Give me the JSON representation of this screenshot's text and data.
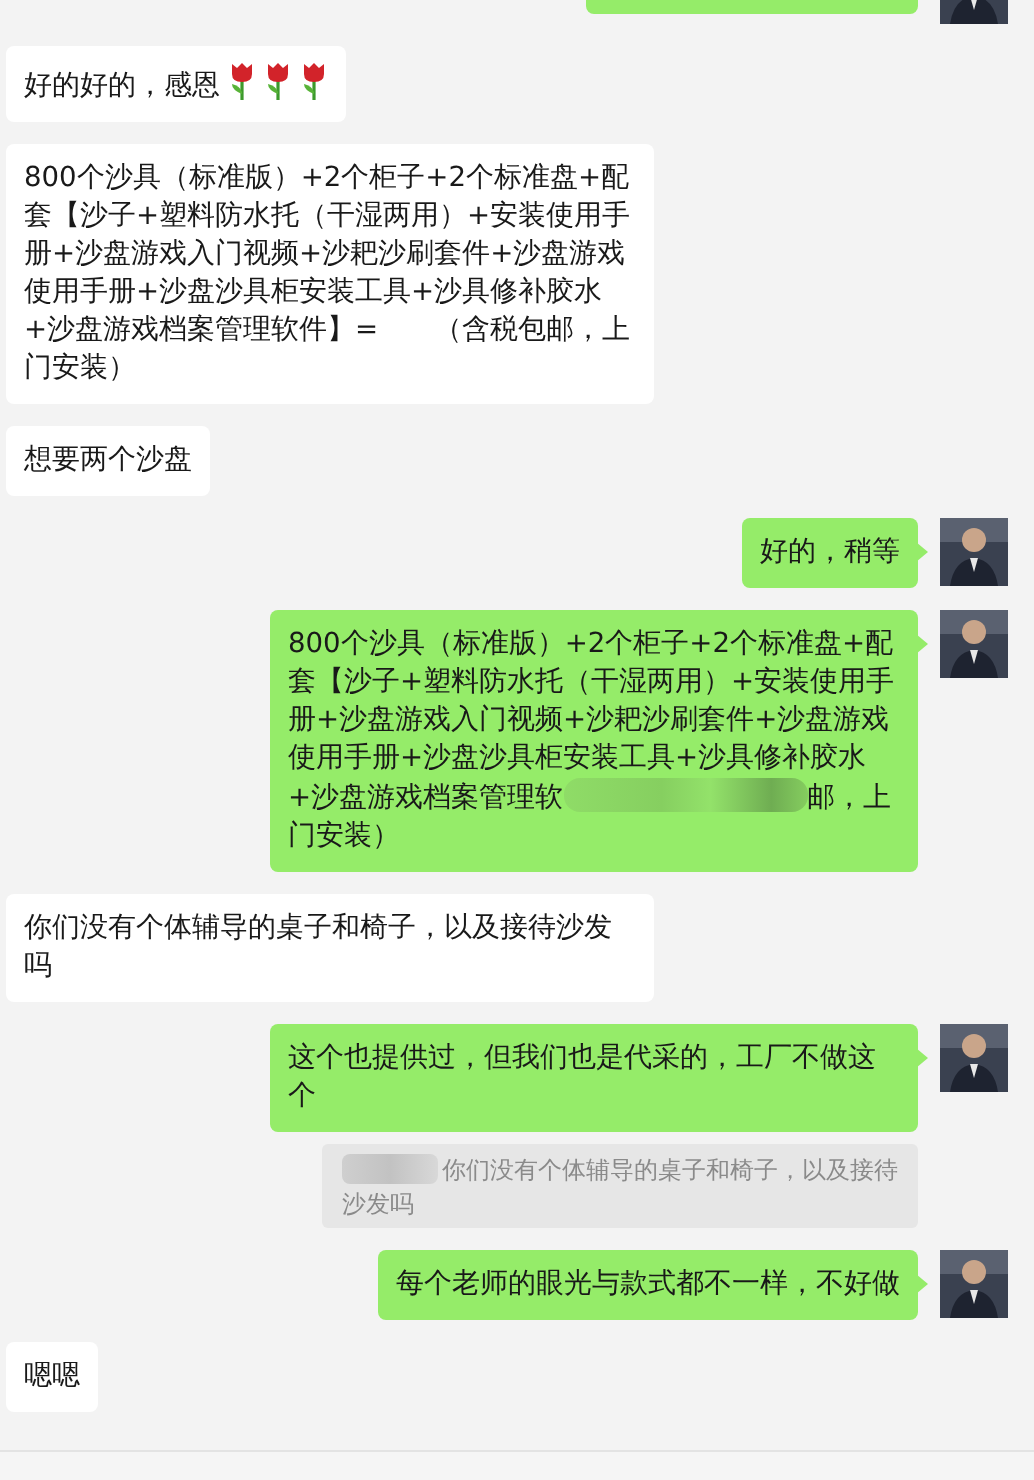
{
  "messages": [
    {
      "kind": "cut",
      "outgoing": true
    },
    {
      "kind": "text",
      "outgoing": false,
      "text": "好的好的，感恩",
      "emojis": [
        {
          "kind": "tulip"
        },
        {
          "kind": "tulip"
        },
        {
          "kind": "tulip"
        }
      ]
    },
    {
      "kind": "text",
      "outgoing": false,
      "text": "800个沙具（标准版）+2个柜子+2个标准盘+配套【沙子+塑料防水托（干湿两用）+安装使用手册+沙盘游戏入门视频+沙耙沙刷套件+沙盘游戏使用手册+沙盘沙具柜安装工具+沙具修补胶水+沙盘游戏档案管理软件】=　　（含税包邮，上门安装）"
    },
    {
      "kind": "text",
      "outgoing": false,
      "text": "想要两个沙盘"
    },
    {
      "kind": "text",
      "outgoing": true,
      "text": "好的，稍等"
    },
    {
      "kind": "redacted",
      "outgoing": true,
      "text": "800个沙具（标准版）+2个柜子+2个标准盘+配套【沙子+塑料防水托（干湿两用）+安装使用手册+沙盘游戏入门视频+沙耙沙刷套件+沙盘游戏使用手册+沙盘沙具柜安装工具+沙具修补胶水+沙盘游戏档案管理软",
      "text_after": "邮，上门安装）"
    },
    {
      "kind": "text",
      "outgoing": false,
      "text": "你们没有个体辅导的桌子和椅子，以及接待沙发吗"
    },
    {
      "kind": "text",
      "outgoing": true,
      "text": "这个也提供过，但我们也是代采的，工厂不做这个",
      "quote": "你们没有个体辅导的桌子和椅子，以及接待沙发吗"
    },
    {
      "kind": "text",
      "outgoing": true,
      "text": "每个老师的眼光与款式都不一样，不好做"
    },
    {
      "kind": "text",
      "outgoing": false,
      "text": "嗯嗯"
    }
  ]
}
